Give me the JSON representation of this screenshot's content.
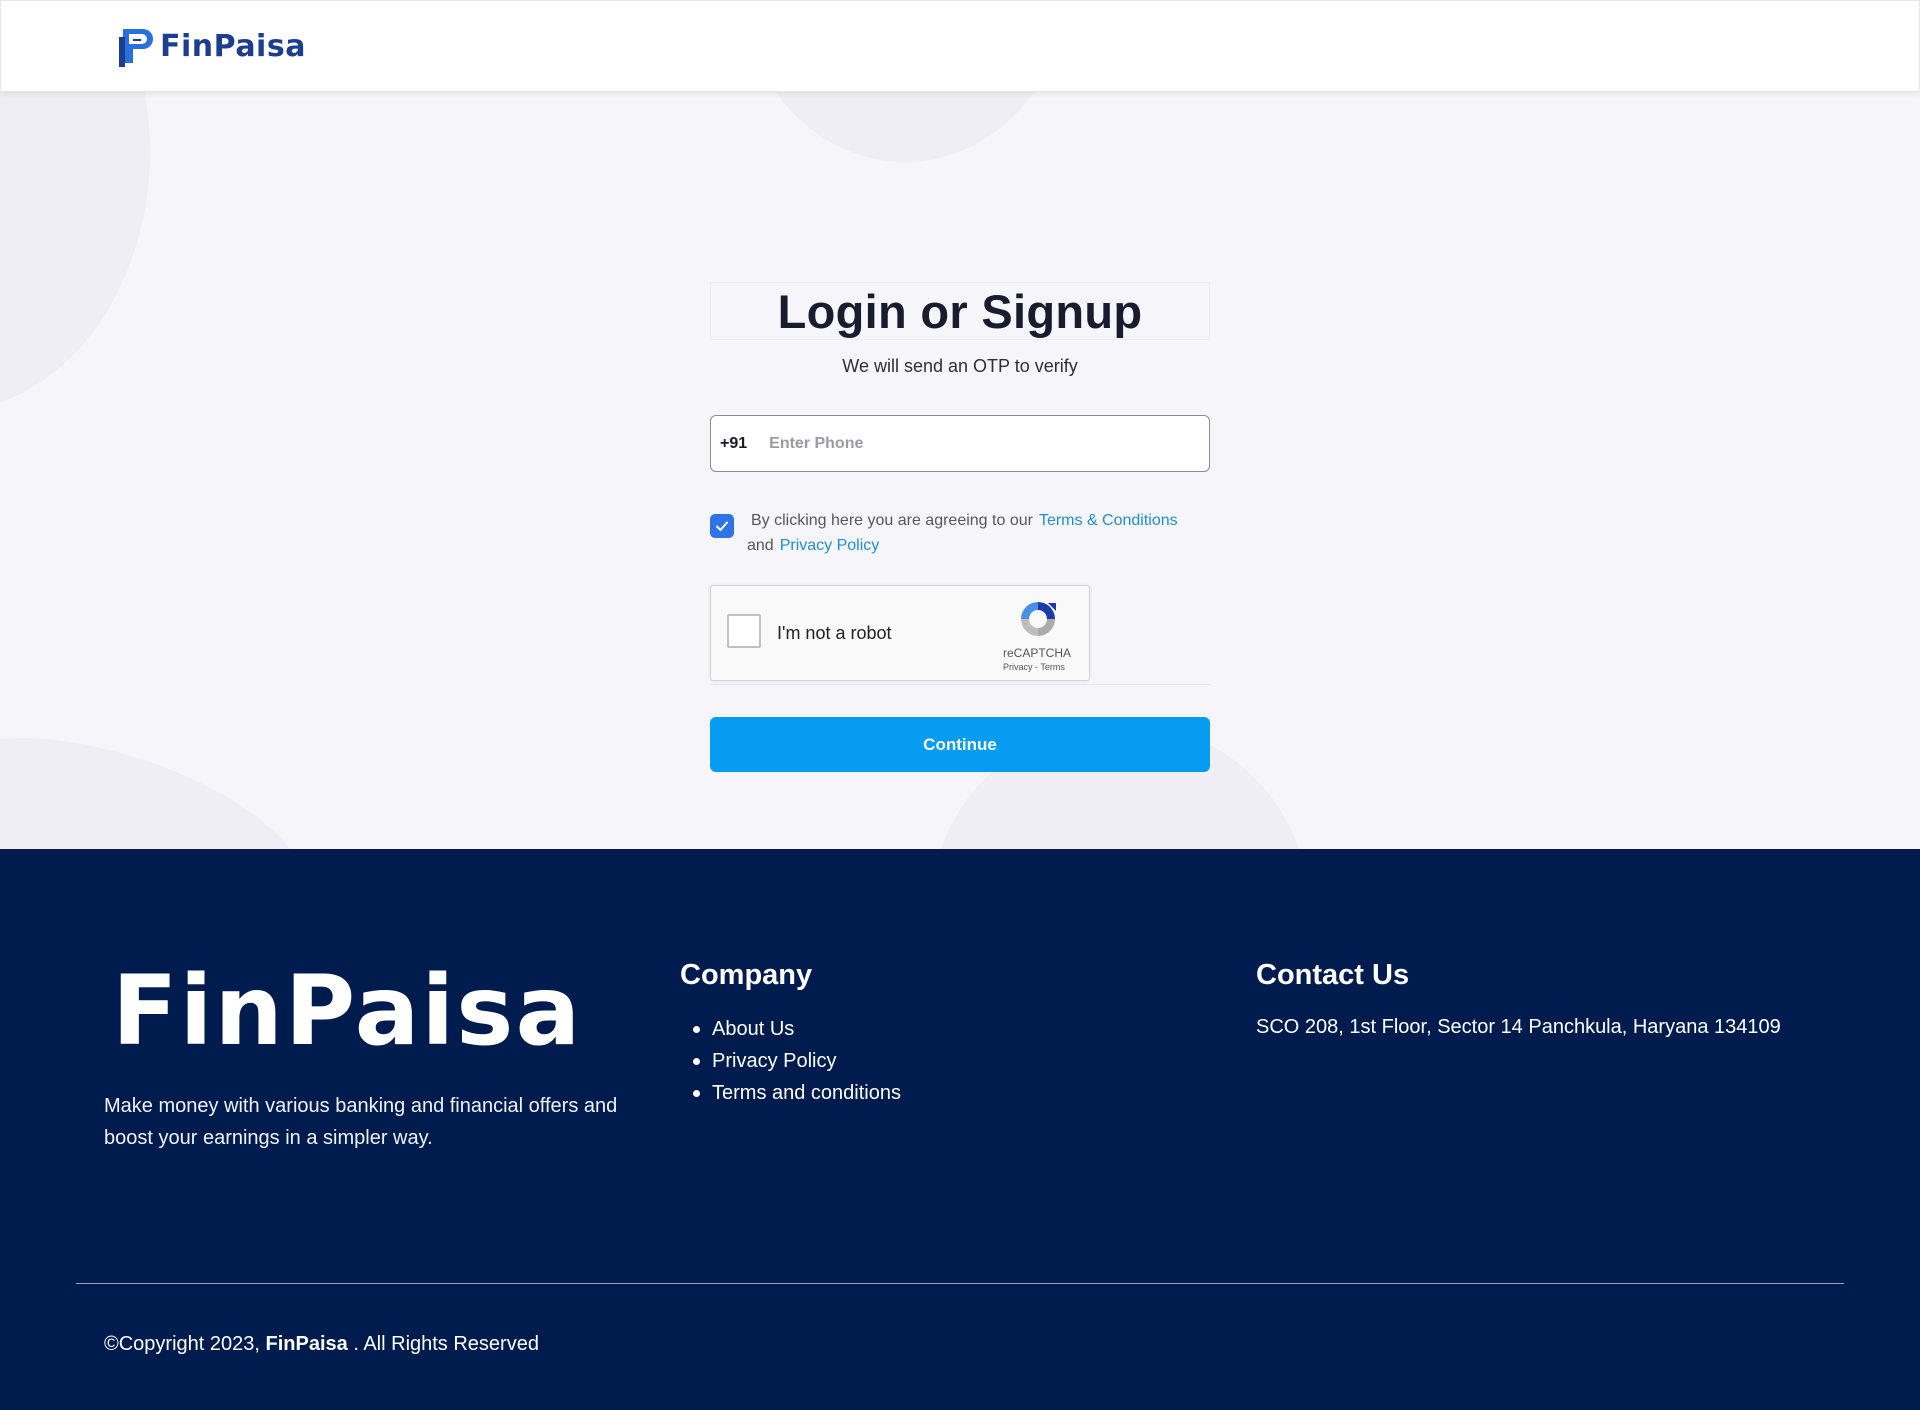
{
  "header": {
    "logo_text": "FinPaisa",
    "brand_color": "#1d3d8f",
    "accent_color": "#2a6fe0"
  },
  "login": {
    "title": "Login or Signup",
    "subtitle": "We will send an OTP to verify",
    "country_code": "+91",
    "phone_placeholder": "Enter Phone",
    "phone_value": "",
    "agree_checked": true,
    "agree_text": "By clicking here you are agreeing to our",
    "terms_link": "Terms & Conditions",
    "and_text": "and",
    "privacy_link": "Privacy Policy",
    "continue_label": "Continue",
    "button_color": "#069cf2"
  },
  "recaptcha": {
    "label": "I'm not a robot",
    "brand": "reCAPTCHA",
    "links": "Privacy - Terms",
    "icon": "recaptcha-logo-icon"
  },
  "footer": {
    "logo_text": "FinPaisa",
    "tagline": "Make money with various banking and financial offers and boost your earnings in a simpler way.",
    "company_title": "Company",
    "company_links": [
      "About Us",
      "Privacy Policy",
      "Terms and conditions"
    ],
    "contact_title": "Contact Us",
    "address": "SCO 208, 1st Floor, Sector 14 Panchkula, Haryana 134109",
    "copyright_prefix": "©Copyright 2023,",
    "copyright_brand": "FinPaisa",
    "copyright_suffix": ". All Rights Reserved",
    "background_color": "#001c4e"
  }
}
